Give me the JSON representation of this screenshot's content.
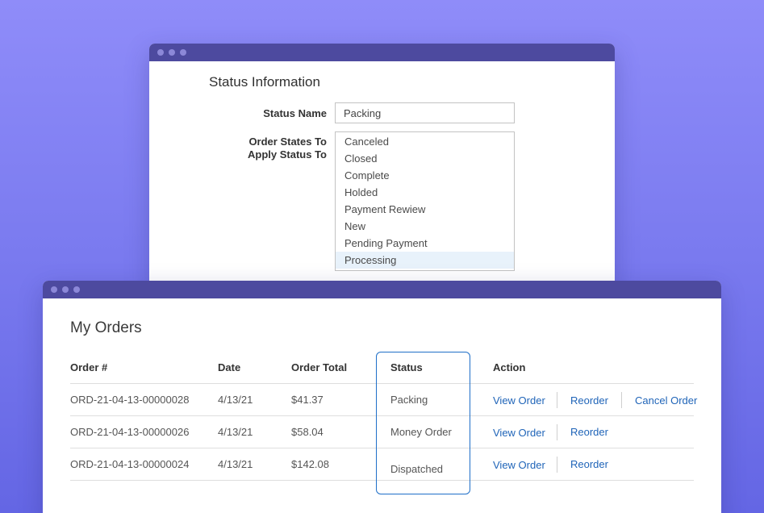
{
  "status_window": {
    "title": "Status Information",
    "status_name_label": "Status Name",
    "status_name_value": "Packing",
    "order_states_label_line1": "Order States To",
    "order_states_label_line2": "Apply Status To",
    "order_states": [
      {
        "label": "Canceled",
        "selected": false
      },
      {
        "label": "Closed",
        "selected": false
      },
      {
        "label": "Complete",
        "selected": false
      },
      {
        "label": "Holded",
        "selected": false
      },
      {
        "label": "Payment Rewiew",
        "selected": false
      },
      {
        "label": "New",
        "selected": false
      },
      {
        "label": "Pending Payment",
        "selected": false
      },
      {
        "label": "Processing",
        "selected": true
      }
    ]
  },
  "orders_window": {
    "title": "My Orders",
    "columns": {
      "order": "Order #",
      "date": "Date",
      "total": "Order Total",
      "status": "Status",
      "action": "Action"
    },
    "rows": [
      {
        "order": "ORD-21-04-13-00000028",
        "date": "4/13/21",
        "total": "$41.37",
        "status": "Packing",
        "actions": [
          "View Order",
          "Reorder",
          "Cancel Order"
        ]
      },
      {
        "order": "ORD-21-04-13-00000026",
        "date": "4/13/21",
        "total": "$58.04",
        "status": "Money Order",
        "actions": [
          "View Order",
          "Reorder"
        ]
      },
      {
        "order": "ORD-21-04-13-00000024",
        "date": "4/13/21",
        "total": "$142.08",
        "status": "Dispatched",
        "actions": [
          "View Order",
          "Reorder"
        ]
      }
    ]
  },
  "colors": {
    "background_top": "#8f8cf9",
    "background_bottom": "#6466e4",
    "titlebar": "#4d4a9f",
    "link": "#1f64b8",
    "status_highlight_border": "#1f6fc8",
    "selected_option_bg": "#e8f2fb"
  }
}
